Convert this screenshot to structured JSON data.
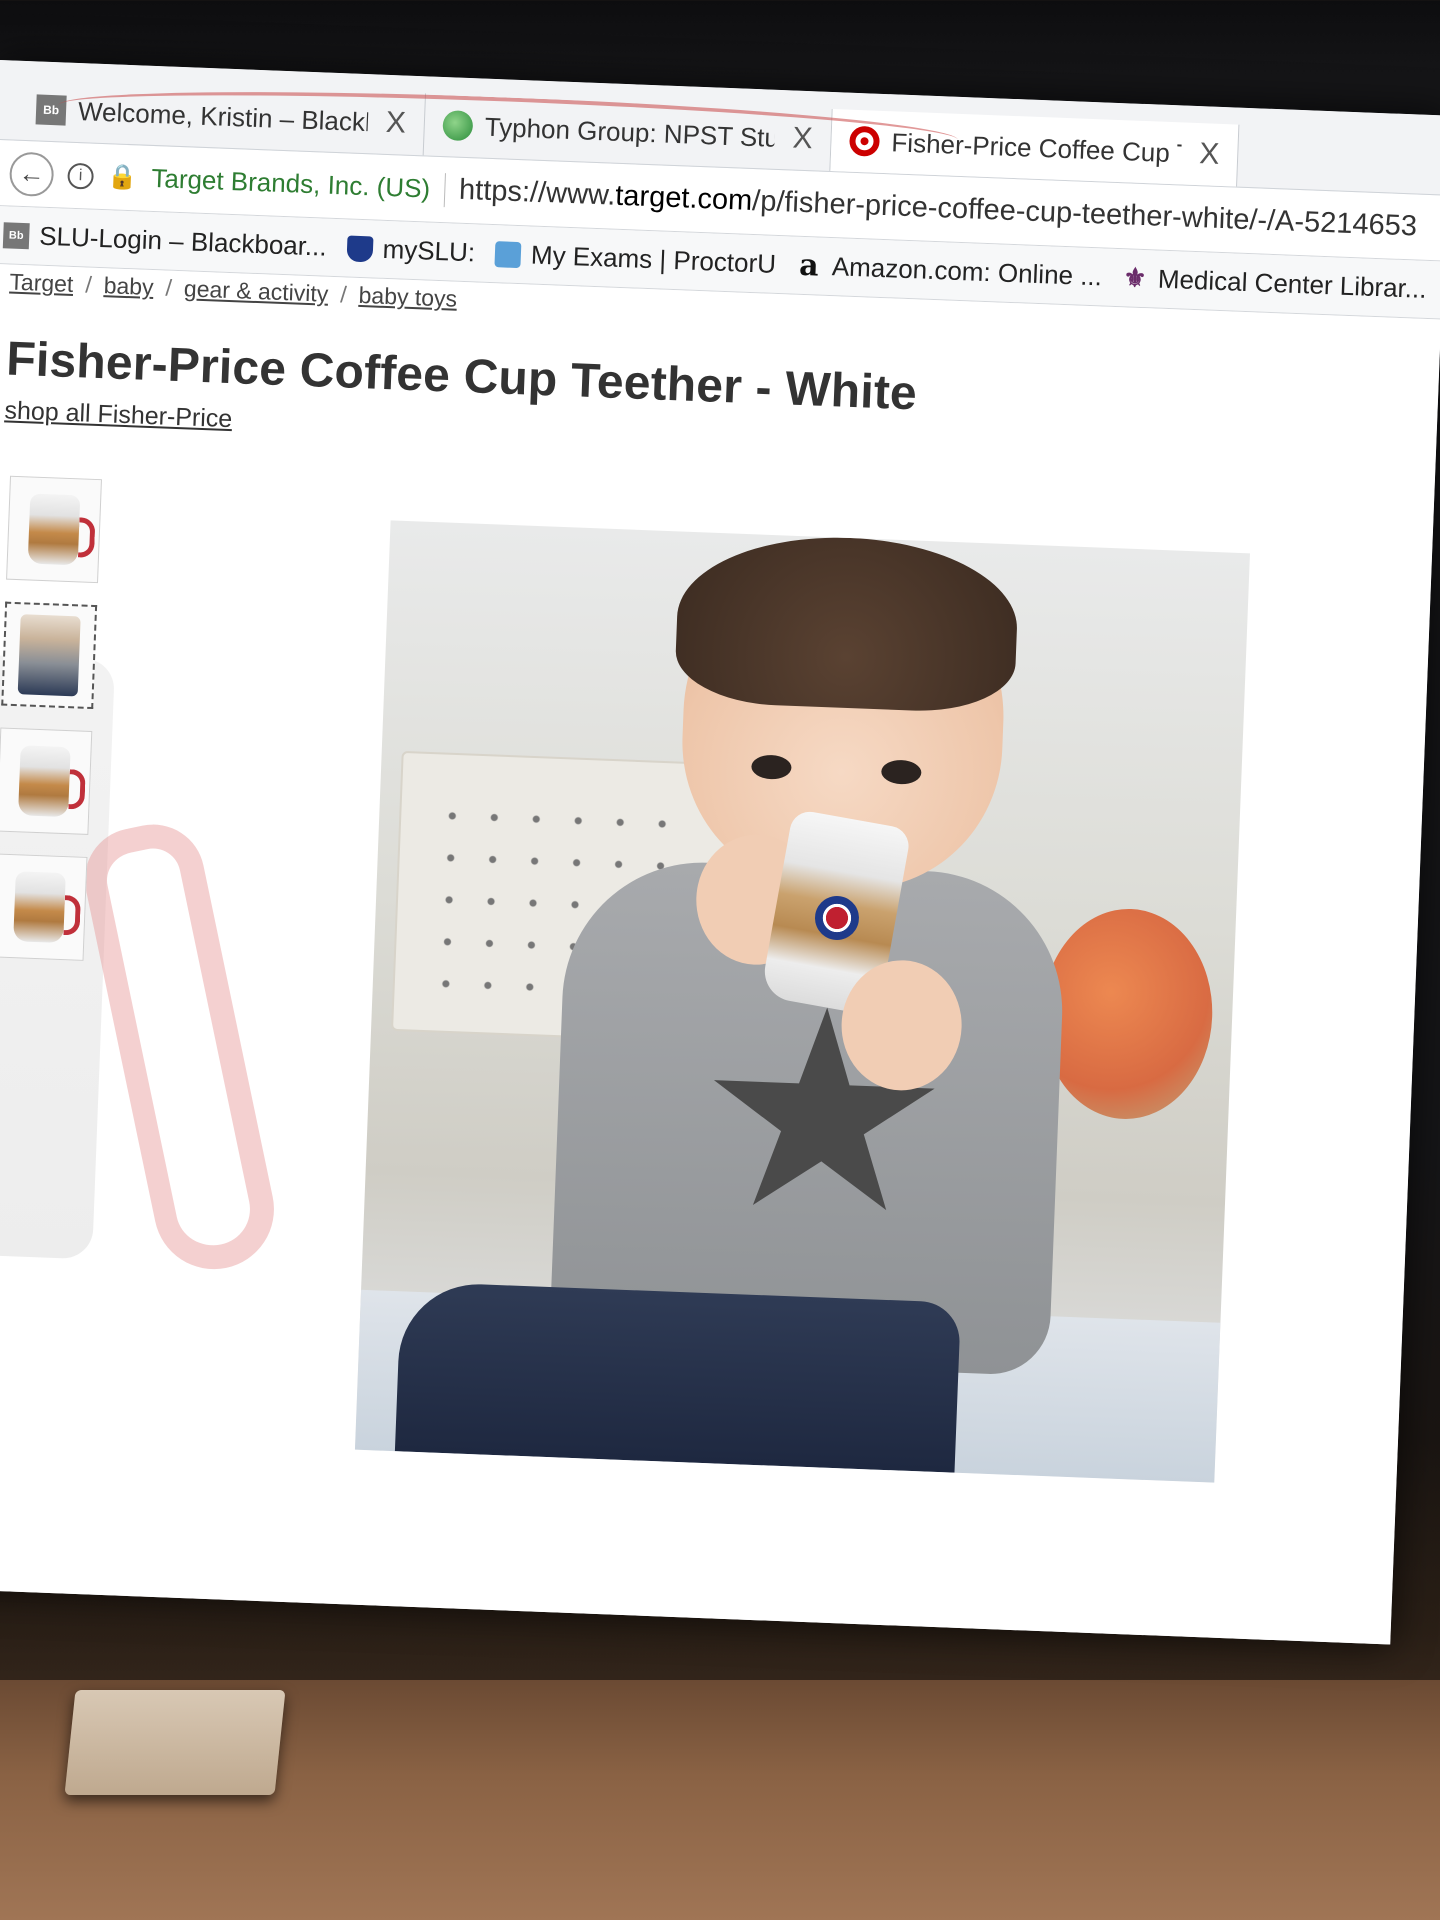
{
  "tabs": [
    {
      "favicon": "blackboard-icon",
      "label": "Welcome, Kristin – Blackboa",
      "active": false
    },
    {
      "favicon": "globe-icon",
      "label": "Typhon Group: NPST Studen",
      "active": false
    },
    {
      "favicon": "target-icon",
      "label": "Fisher-Price Coffee Cup Teet",
      "active": true
    }
  ],
  "tab_close_glyph": "X",
  "address_bar": {
    "identity": "Target Brands, Inc. (US)",
    "url_prefix": "https://www.",
    "url_host": "target.com",
    "url_path": "/p/fisher-price-coffee-cup-teether-white/-/A-5214653"
  },
  "bookmarks": [
    {
      "icon": "blackboard-icon",
      "label": "SLU-Login – Blackboar..."
    },
    {
      "icon": "shield-icon",
      "label": "mySLU:"
    },
    {
      "icon": "proctoru-icon",
      "label": "My Exams | ProctorU"
    },
    {
      "icon": "amazon-icon",
      "label": "Amazon.com: Online ..."
    },
    {
      "icon": "fleur-icon",
      "label": "Medical Center Librar..."
    }
  ],
  "breadcrumb": [
    "Target",
    "baby",
    "gear & activity",
    "baby toys"
  ],
  "product": {
    "title": "Fisher-Price Coffee Cup Teether - White",
    "shop_link": "shop all Fisher-Price",
    "thumbnails": [
      "cup-front",
      "baby-drinking",
      "cup-top",
      "cup-side"
    ],
    "selected_thumbnail": 1
  },
  "colors": {
    "target_red": "#cc0000",
    "link_text": "#444444",
    "secure_green": "#2e7d32"
  }
}
